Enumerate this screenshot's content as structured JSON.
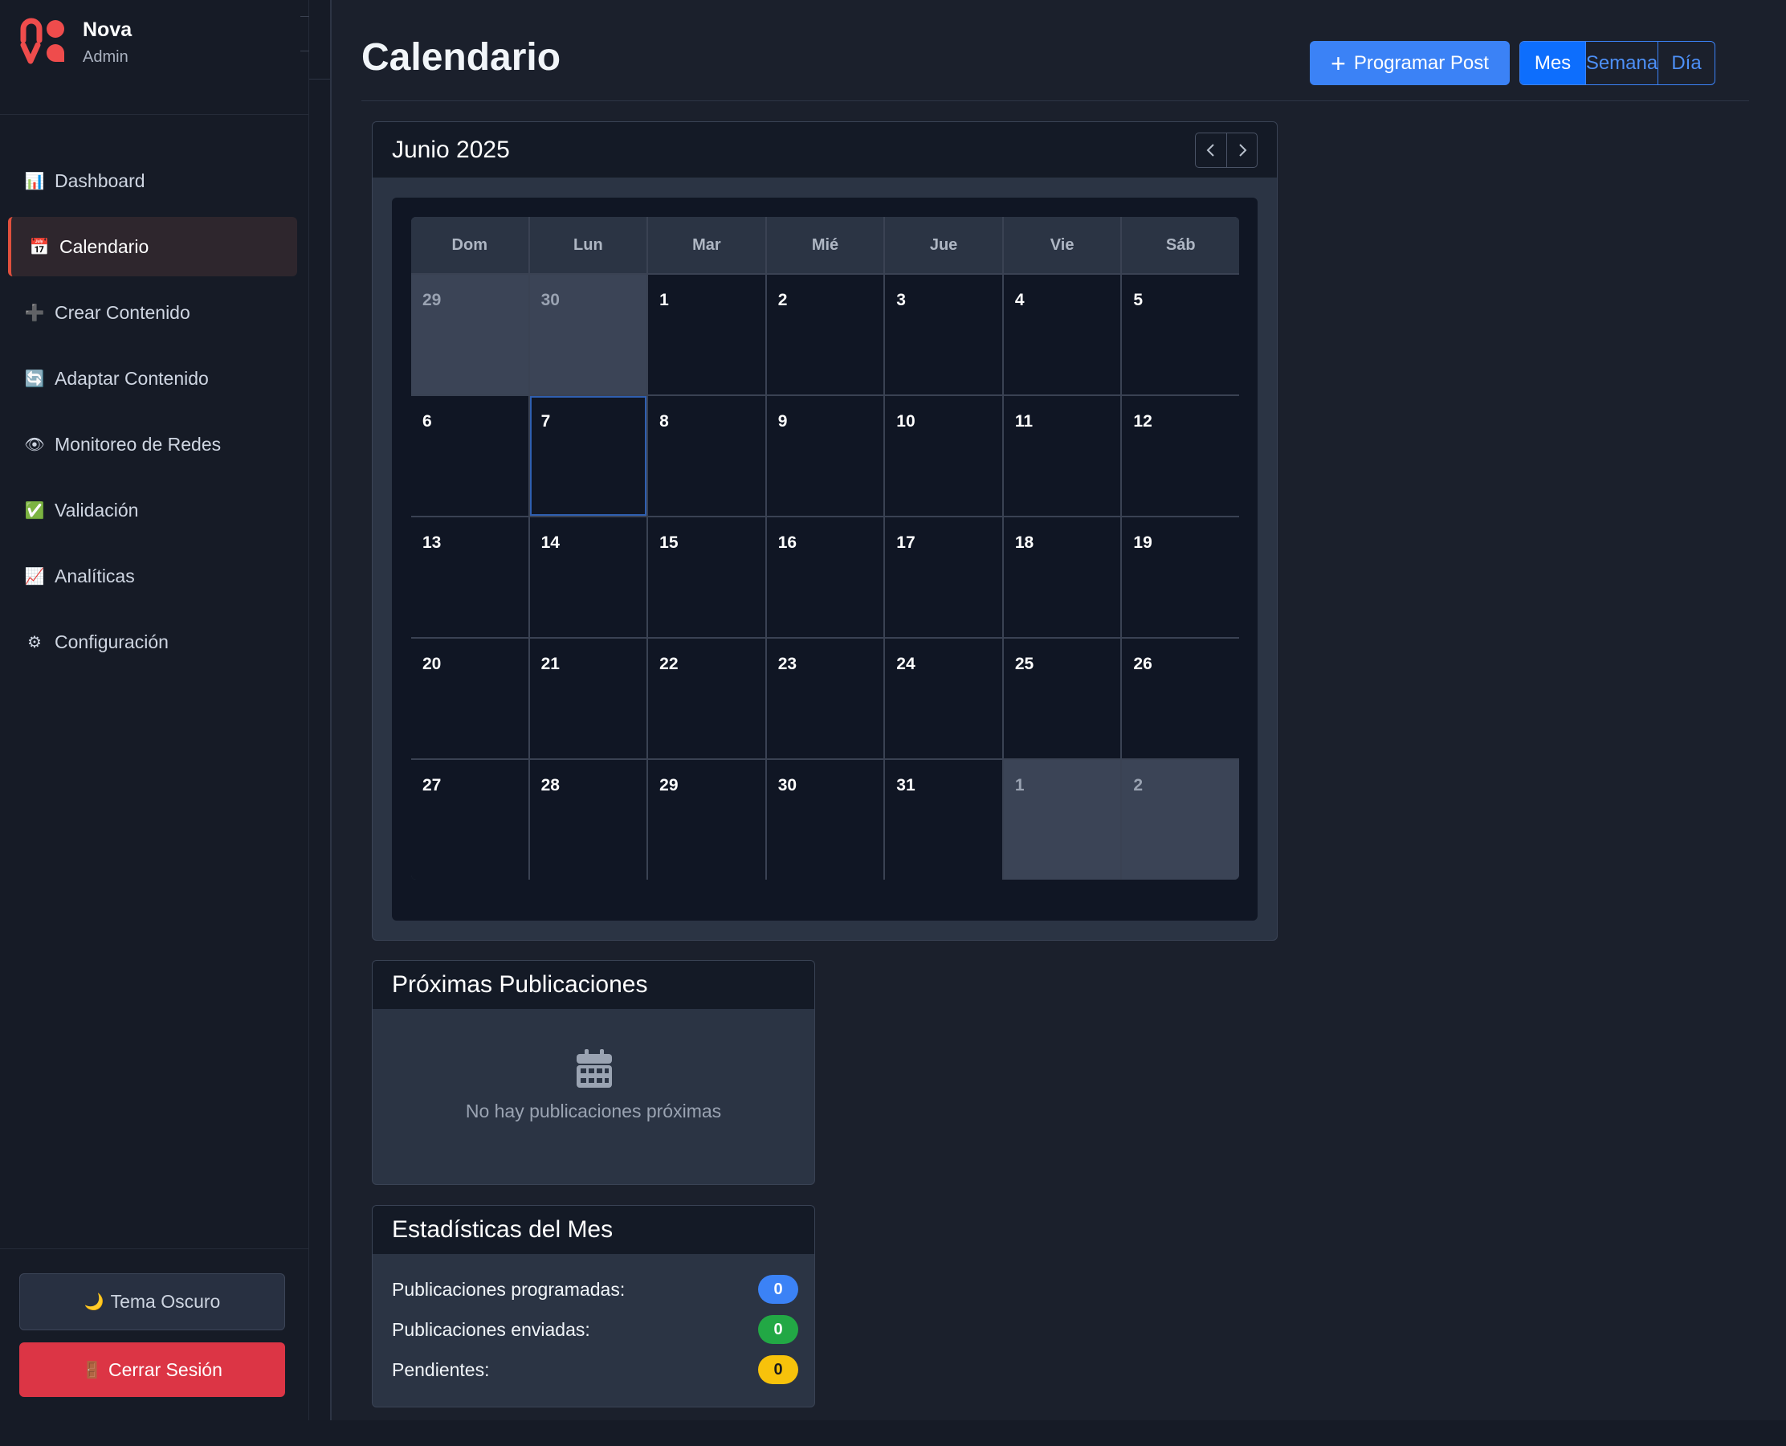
{
  "brand": {
    "name": "Nova",
    "role": "Admin"
  },
  "nav": [
    {
      "label": "Dashboard",
      "icon": "bar-chart-icon",
      "glyph": "📊"
    },
    {
      "label": "Calendario",
      "icon": "calendar-icon",
      "glyph": "📅",
      "active": true
    },
    {
      "label": "Crear Contenido",
      "icon": "plus-icon",
      "glyph": "➕"
    },
    {
      "label": "Adaptar Contenido",
      "icon": "refresh-icon",
      "glyph": "🔄"
    },
    {
      "label": "Monitoreo de Redes",
      "icon": "eye-icon",
      "glyph": "👁"
    },
    {
      "label": "Validación",
      "icon": "check-icon",
      "glyph": "✅"
    },
    {
      "label": "Analíticas",
      "icon": "line-chart-icon",
      "glyph": "📈"
    },
    {
      "label": "Configuración",
      "icon": "gear-icon",
      "glyph": "⚙"
    }
  ],
  "sidebar_footer": {
    "theme_label": "Tema Oscuro",
    "theme_icon": "🌙",
    "logout_label": "Cerrar Sesión",
    "logout_icon": "🚪"
  },
  "header": {
    "title": "Calendario",
    "program_label": "Programar Post",
    "views": [
      "Mes",
      "Semana",
      "Día"
    ],
    "active_view": "Mes"
  },
  "calendar": {
    "month_label": "Junio 2025",
    "weekdays": [
      "Dom",
      "Lun",
      "Mar",
      "Mié",
      "Jue",
      "Vie",
      "Sáb"
    ],
    "days": [
      {
        "n": "29",
        "other": true
      },
      {
        "n": "30",
        "other": true
      },
      {
        "n": "1"
      },
      {
        "n": "2"
      },
      {
        "n": "3"
      },
      {
        "n": "4"
      },
      {
        "n": "5"
      },
      {
        "n": "6"
      },
      {
        "n": "7",
        "today": true
      },
      {
        "n": "8"
      },
      {
        "n": "9"
      },
      {
        "n": "10"
      },
      {
        "n": "11"
      },
      {
        "n": "12"
      },
      {
        "n": "13"
      },
      {
        "n": "14"
      },
      {
        "n": "15"
      },
      {
        "n": "16"
      },
      {
        "n": "17"
      },
      {
        "n": "18"
      },
      {
        "n": "19"
      },
      {
        "n": "20"
      },
      {
        "n": "21"
      },
      {
        "n": "22"
      },
      {
        "n": "23"
      },
      {
        "n": "24"
      },
      {
        "n": "25"
      },
      {
        "n": "26"
      },
      {
        "n": "27"
      },
      {
        "n": "28"
      },
      {
        "n": "29"
      },
      {
        "n": "30"
      },
      {
        "n": "31"
      },
      {
        "n": "1",
        "other": true
      },
      {
        "n": "2",
        "other": true
      }
    ]
  },
  "upcoming": {
    "title": "Próximas Publicaciones",
    "empty_text": "No hay publicaciones próximas"
  },
  "stats": {
    "title": "Estadísticas del Mes",
    "rows": [
      {
        "label": "Publicaciones programadas:",
        "value": "0",
        "color": "blue"
      },
      {
        "label": "Publicaciones enviadas:",
        "value": "0",
        "color": "green"
      },
      {
        "label": "Pendientes:",
        "value": "0",
        "color": "yellow"
      }
    ]
  }
}
